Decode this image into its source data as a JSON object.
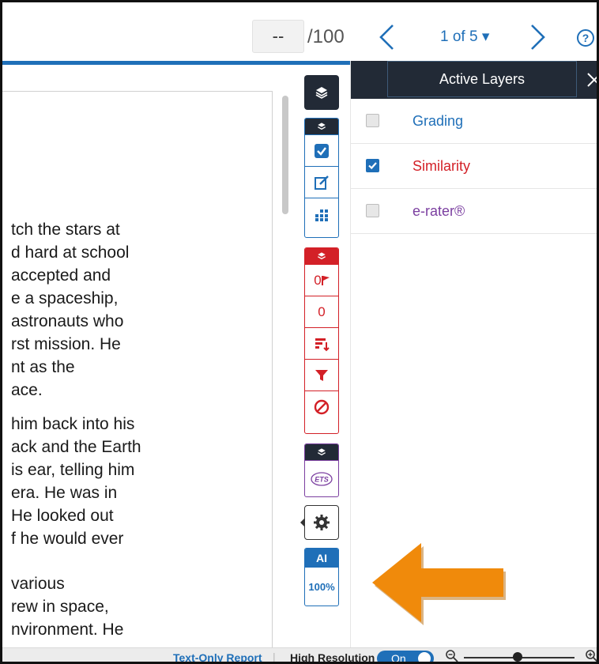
{
  "header": {
    "score_placeholder": "--",
    "score_total": "/100",
    "page_indicator": "1 of 5 ▾",
    "help_label": "?"
  },
  "document": {
    "paragraph1": [
      "tch the stars at",
      "d hard at school",
      " accepted and",
      "e a spaceship,",
      " astronauts who",
      "rst mission. He",
      "nt as the",
      "ace."
    ],
    "paragraph2": [
      "him back into his",
      "ack and the Earth",
      "is ear, telling him",
      "era. He was in",
      "He looked out",
      "f he would ever"
    ],
    "paragraph3": [
      "various",
      "rew in space,",
      "nvironment. He"
    ]
  },
  "toolbar": {
    "flag_count": "0",
    "red_count": "0",
    "ets_label": "ETS",
    "ai_label": "AI",
    "ai_score": "100%"
  },
  "panel": {
    "title": "Active Layers",
    "layers": [
      {
        "name": "Grading",
        "checked": false,
        "color": "#1f6fb8"
      },
      {
        "name": "Similarity",
        "checked": true,
        "color": "#d32027"
      },
      {
        "name": "e-rater®",
        "checked": false,
        "color": "#7b3fa0"
      }
    ]
  },
  "footer": {
    "text_only_report": "Text-Only Report",
    "separator": "|",
    "high_resolution": "High Resolution",
    "toggle_state": "On"
  },
  "colors": {
    "accent_blue": "#1f6fb8",
    "dark_navy": "#222a36",
    "alert_red": "#d32027",
    "ets_purple": "#7b3fa0",
    "arrow_orange": "#f08a0b"
  }
}
